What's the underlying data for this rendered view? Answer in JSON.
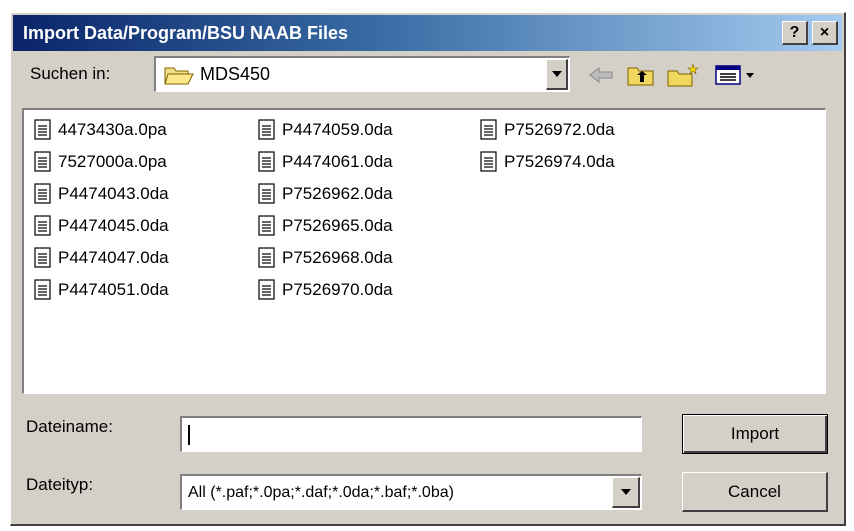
{
  "window": {
    "title": "Import Data/Program/BSU NAAB Files",
    "help_label": "?",
    "close_label": "×"
  },
  "lookin": {
    "label": "Suchen in:",
    "value": "MDS450"
  },
  "files": [
    "4473430a.0pa",
    "7527000a.0pa",
    "P4474043.0da",
    "P4474045.0da",
    "P4474047.0da",
    "P4474051.0da",
    "P4474059.0da",
    "P4474061.0da",
    "P7526962.0da",
    "P7526965.0da",
    "P7526968.0da",
    "P7526970.0da",
    "P7526972.0da",
    "P7526974.0da"
  ],
  "filename": {
    "label": "Dateiname:",
    "value": ""
  },
  "filetype": {
    "label": "Dateityp:",
    "value": "All (*.paf;*.0pa;*.daf;*.0da;*.baf;*.0ba)"
  },
  "buttons": {
    "import": "Import",
    "cancel": "Cancel"
  }
}
